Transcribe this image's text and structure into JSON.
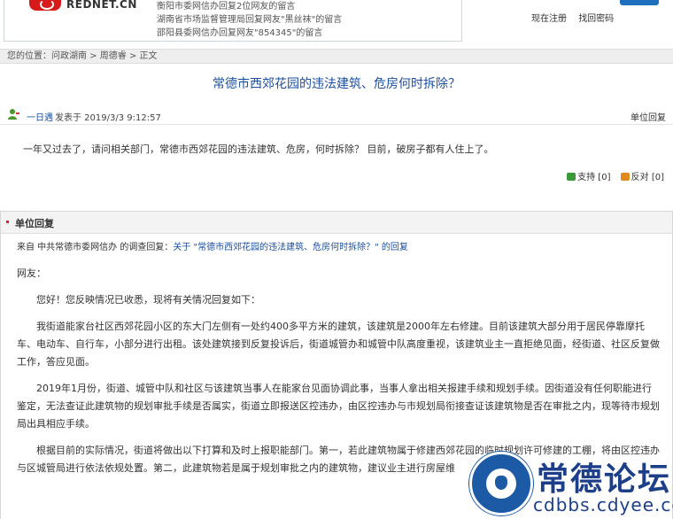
{
  "header": {
    "logo_text": "REDNET.CN",
    "news": [
      "衡阳市委网信办回复2位网友的留言",
      "湖南省市场监督管理局回复网友\"黑丝袜\"的留言",
      "邵阳县委网信办回复网友\"854345\"的留言"
    ],
    "register_label": "现在注册",
    "recover_label": "找回密码"
  },
  "breadcrumb": "您的位置：问政湖南 > 周德睿 > 正文",
  "post": {
    "title": "常德市西郊花园的违法建筑、危房何时拆除？",
    "author": "一日遇",
    "posted_at": "发表于 2019/3/3 9:12:57",
    "unit_reply_label": "单位回复",
    "content": "一年又过去了，请问相关部门，常德市西郊花园的违法建筑、危房，何时拆除？ 目前，破房子都有人住上了。",
    "support_label": "支持 [0]",
    "oppose_label": "反对 [0]"
  },
  "reply": {
    "section_title": "单位回复",
    "from_prefix": "来自 中共常德市委网信办 的调查回复：",
    "from_link": "关于 \"常德市西郊花园的违法建筑、危房何时拆除？\" 的回复",
    "greeting": "网友：",
    "paragraphs": [
      "您好！您反映情况已收悉，现将有关情况回复如下：",
      "我街道能家台社区西郊花园小区的东大门左侧有一处约400多平方米的建筑，该建筑是2000年左右修建。目前该建筑大部分用于居民停靠摩托车、电动车、自行车，小部分进行出租。该处建筑接到反复投诉后，街道城管办和城管中队高度重视，该建筑业主一直拒绝见面，经街道、社区反复做工作，答应见面。",
      "2019年1月份，街道、城管中队和社区与该建筑当事人在能家台见面协调此事，当事人拿出相关报建手续和规划手续。因街道没有任何职能进行鉴定，无法查证此建筑物的规划审批手续是否属实，街道立即报送区控违办，由区控违办与市规划局衔接查证该建筑物是否在审批之内，现等待市规划局出具相应手续。",
      "根据目前的实际情况，街道将做出以下打算和及时上报职能部门。第一，若此建筑物属于修建西郊花园的临时规划许可修建的工棚，将由区控违办与区城管局进行依法依规处置。第二，此建筑物若是属于规划审批之内的建筑物，建议业主进行房屋维"
    ]
  },
  "watermark": {
    "name": "常德论坛",
    "url": "cdbbs.cdyee.com"
  },
  "colors": {
    "link_blue": "#1a4fa0",
    "brand_red": "#d71a1a",
    "support_green": "#3a9a3a",
    "oppose_orange": "#e08a1e"
  }
}
